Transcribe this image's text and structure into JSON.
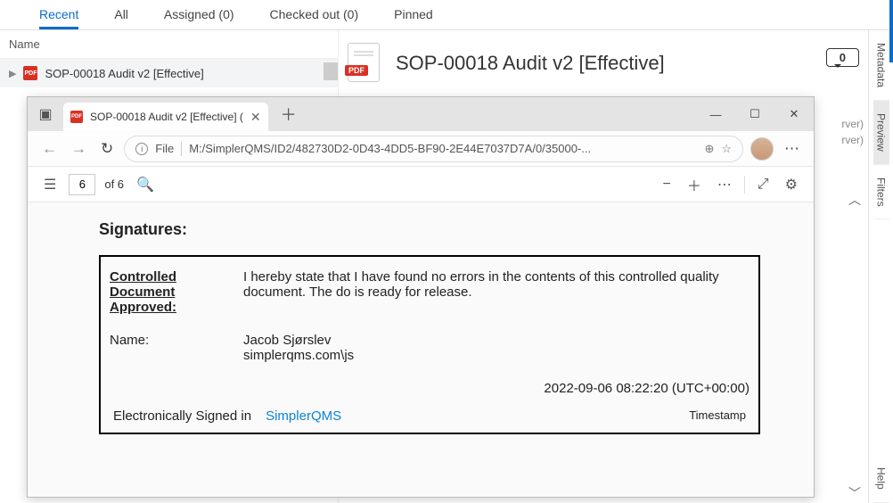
{
  "tabs": {
    "items": [
      "Recent",
      "All",
      "Assigned (0)",
      "Checked out (0)",
      "Pinned"
    ],
    "active": 0
  },
  "list": {
    "header": "Name",
    "rows": [
      {
        "icon": "PDF",
        "label": "SOP-00018 Audit v2 [Effective]"
      }
    ]
  },
  "preview": {
    "title": "SOP-00018 Audit v2 [Effective]",
    "comment_count": "0",
    "server_lines": [
      "rver)",
      "rver)"
    ]
  },
  "rail": {
    "items": [
      "Metadata",
      "Preview",
      "Filters",
      "Help"
    ],
    "active": 1
  },
  "browser": {
    "tab_title": "SOP-00018 Audit v2 [Effective] (",
    "addr_label": "File",
    "url": "M:/SimplerQMS/ID2/482730D2-0D43-4DD5-BF90-2E44E7037D7A/0/35000-..."
  },
  "pdfbar": {
    "page": "6",
    "of_label": "of 6"
  },
  "document": {
    "sig_heading": "Signatures:",
    "approved_label": "Controlled Document Approved:",
    "statement": "I hereby state that I have found no errors in the contents of this controlled quality document. The do is ready for release.",
    "name_label": "Name:",
    "name_value": "Jacob Sjørslev",
    "domain_value": "simplerqms.com\\js",
    "timestamp_value": "2022-09-06 08:22:20 (UTC+00:00)",
    "esig_label": "Electronically Signed in",
    "brand_prefix": "Simpler",
    "brand_suffix": "QMS",
    "ts_label": "Timestamp"
  }
}
